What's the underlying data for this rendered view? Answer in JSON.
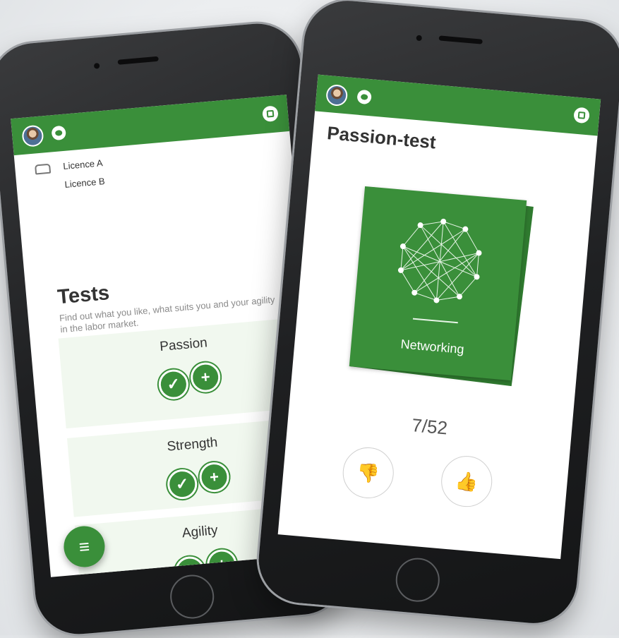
{
  "left_phone": {
    "licences": [
      "Licence A",
      "Licence B"
    ],
    "tests_title": "Tests",
    "tests_desc": "Find out what you like, what suits you and your agility in the labor market.",
    "tests": [
      {
        "label": "Passion"
      },
      {
        "label": "Strength"
      },
      {
        "label": "Agility"
      }
    ],
    "menu_icon": "menu-icon"
  },
  "right_phone": {
    "title": "Passion-test",
    "card_label": "Networking",
    "progress": "7/52",
    "dislike_icon": "thumbs-down-icon",
    "like_icon": "thumbs-up-icon"
  },
  "colors": {
    "brand_green": "#3a8f3a",
    "card_bg": "#f1f8ef"
  }
}
